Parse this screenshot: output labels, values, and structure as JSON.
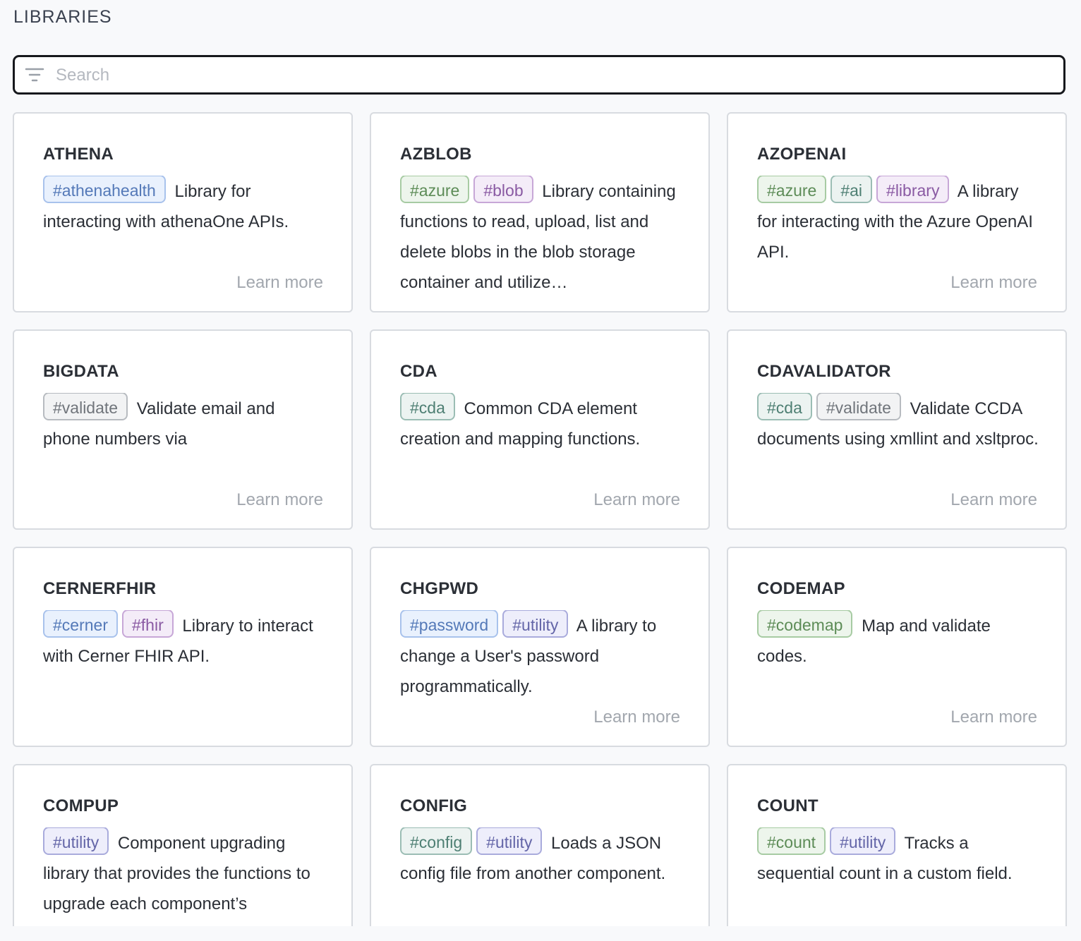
{
  "header": {
    "title": "LIBRARIES"
  },
  "search": {
    "placeholder": "Search",
    "value": ""
  },
  "learn_more_label": "Learn more",
  "tag_colors": {
    "blue": "#5479b8",
    "green": "#5d8c57",
    "purple": "#8a5aa3",
    "teal": "#4e7f73",
    "gray": "#70757b",
    "indigo": "#6466a8"
  },
  "libraries": [
    {
      "name": "ATHENA",
      "tags": [
        {
          "label": "#athenahealth",
          "color": "blue"
        }
      ],
      "description": "Library for interacting with athenaOne APIs.",
      "learn_more": true
    },
    {
      "name": "AZBLOB",
      "tags": [
        {
          "label": "#azure",
          "color": "green"
        },
        {
          "label": "#blob",
          "color": "purple"
        }
      ],
      "description": "Library containing functions to read, upload, list and delete blobs in the blob storage container and utilize…",
      "learn_more": false
    },
    {
      "name": "AZOPENAI",
      "tags": [
        {
          "label": "#azure",
          "color": "green"
        },
        {
          "label": "#ai",
          "color": "teal"
        },
        {
          "label": "#library",
          "color": "purple"
        }
      ],
      "description": "A library for interacting with the Azure OpenAI API.",
      "learn_more": true
    },
    {
      "name": "BIGDATA",
      "tags": [
        {
          "label": "#validate",
          "color": "gray"
        }
      ],
      "description": "Validate email and phone numbers via",
      "learn_more": true
    },
    {
      "name": "CDA",
      "tags": [
        {
          "label": "#cda",
          "color": "teal"
        }
      ],
      "description": "Common CDA element creation and mapping functions.",
      "learn_more": true
    },
    {
      "name": "CDAVALIDATOR",
      "tags": [
        {
          "label": "#cda",
          "color": "teal"
        },
        {
          "label": "#validate",
          "color": "gray"
        }
      ],
      "description": "Validate CCDA documents using xmllint and xsltproc.",
      "learn_more": true
    },
    {
      "name": "CERNERFHIR",
      "tags": [
        {
          "label": "#cerner",
          "color": "blue"
        },
        {
          "label": "#fhir",
          "color": "purple"
        }
      ],
      "description": "Library to interact with Cerner FHIR API.",
      "learn_more": false
    },
    {
      "name": "CHGPWD",
      "tags": [
        {
          "label": "#password",
          "color": "blue"
        },
        {
          "label": "#utility",
          "color": "indigo"
        }
      ],
      "description": "A library to change a User's password programmatically.",
      "learn_more": true
    },
    {
      "name": "CODEMAP",
      "tags": [
        {
          "label": "#codemap",
          "color": "green"
        }
      ],
      "description": "Map and validate codes.",
      "learn_more": true
    },
    {
      "name": "COMPUP",
      "tags": [
        {
          "label": "#utility",
          "color": "indigo"
        }
      ],
      "description": "Component upgrading library that provides the functions to upgrade each component’s",
      "learn_more": false
    },
    {
      "name": "CONFIG",
      "tags": [
        {
          "label": "#config",
          "color": "teal"
        },
        {
          "label": "#utility",
          "color": "indigo"
        }
      ],
      "description": "Loads a JSON config file from another component.",
      "learn_more": false
    },
    {
      "name": "COUNT",
      "tags": [
        {
          "label": "#count",
          "color": "green"
        },
        {
          "label": "#utility",
          "color": "indigo"
        }
      ],
      "description": "Tracks a sequential count in a custom field.",
      "learn_more": false
    }
  ]
}
